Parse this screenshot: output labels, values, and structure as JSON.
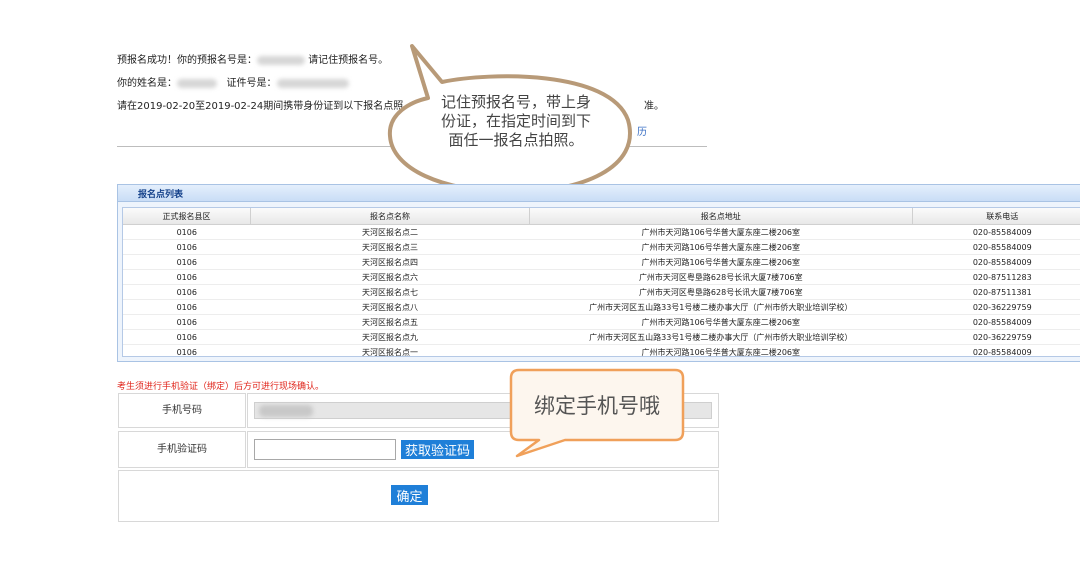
{
  "info": {
    "line1_prefix": "预报名成功！你的预报名号是：",
    "line1_suffix": "请记住预报名号。",
    "line2_name": "你的姓名是：",
    "line2_id": "证件号是：",
    "line3": "请在2019-02-20至2019-02-24期间携带身份证到以下报名点照",
    "line3_tail": "准。",
    "link_partial": "历"
  },
  "panel": {
    "title": "报名点列表",
    "columns": [
      "正式报名县区",
      "报名点名称",
      "报名点地址",
      "联系电话"
    ],
    "rows": [
      [
        "0106",
        "天河区报名点二",
        "广州市天河路106号华普大厦东座二楼206室",
        "020-85584009"
      ],
      [
        "0106",
        "天河区报名点三",
        "广州市天河路106号华普大厦东座二楼206室",
        "020-85584009"
      ],
      [
        "0106",
        "天河区报名点四",
        "广州市天河路106号华普大厦东座二楼206室",
        "020-85584009"
      ],
      [
        "0106",
        "天河区报名点六",
        "广州市天河区粤垦路628号长讯大厦7楼706室",
        "020-87511283"
      ],
      [
        "0106",
        "天河区报名点七",
        "广州市天河区粤垦路628号长讯大厦7楼706室",
        "020-87511381"
      ],
      [
        "0106",
        "天河区报名点八",
        "广州市天河区五山路33号1号楼二楼办事大厅（广州市侨大职业培训学校）",
        "020-36229759"
      ],
      [
        "0106",
        "天河区报名点五",
        "广州市天河路106号华普大厦东座二楼206室",
        "020-85584009"
      ],
      [
        "0106",
        "天河区报名点九",
        "广州市天河区五山路33号1号楼二楼办事大厅（广州市侨大职业培训学校）",
        "020-36229759"
      ],
      [
        "0106",
        "天河区报名点一",
        "广州市天河路106号华普大厦东座二楼206室",
        "020-85584009"
      ]
    ]
  },
  "form": {
    "warning": "考生须进行手机验证（绑定）后方可进行现场确认。",
    "phone_label": "手机号码",
    "code_label": "手机验证码",
    "code_value": "",
    "get_code_button": "获取验证码",
    "confirm_button": "确定"
  },
  "callouts": {
    "bubble": "记住预报名号，带上身份证，在指定时间到下面任一报名点拍照。",
    "bubble_line1": "记住预报名号，带上身",
    "bubble_line2": "份证，在指定时间到下",
    "bubble_line3": "面任一报名点拍照。",
    "box": "绑定手机号哦"
  },
  "colors": {
    "accent_blue": "#1f7fd8",
    "warning_red": "#e0251b",
    "callout_border": "#b89a78",
    "callout_orange_border": "#f0a05a",
    "callout_orange_fill": "#fdf6ee",
    "panel_title": "#15428b"
  }
}
